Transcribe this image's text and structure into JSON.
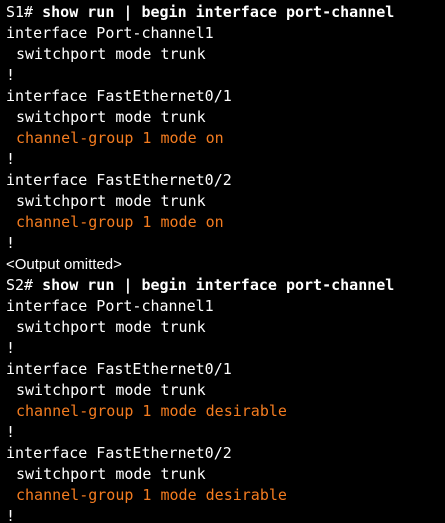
{
  "colors": {
    "background": "#000000",
    "text": "#ffffff",
    "highlight": "#f47c20"
  },
  "terminal": {
    "s1": {
      "prompt": "S1# ",
      "command": "show run | begin interface port-channel",
      "lines": [
        "interface Port-channel1",
        "switchport mode trunk",
        "!",
        "interface FastEthernet0/1",
        "switchport mode trunk",
        "channel-group 1 mode on",
        "!",
        "interface FastEthernet0/2",
        "switchport mode trunk",
        "channel-group 1 mode on",
        "!"
      ]
    },
    "omitted": "<Output omitted>",
    "s2": {
      "prompt": "S2# ",
      "command": "show run | begin interface port-channel",
      "lines": [
        "interface Port-channel1",
        "switchport mode trunk",
        "!",
        "interface FastEthernet0/1",
        "switchport mode trunk",
        "channel-group 1 mode desirable",
        "!",
        "interface FastEthernet0/2",
        "switchport mode trunk",
        "channel-group 1 mode desirable",
        "!"
      ]
    }
  }
}
